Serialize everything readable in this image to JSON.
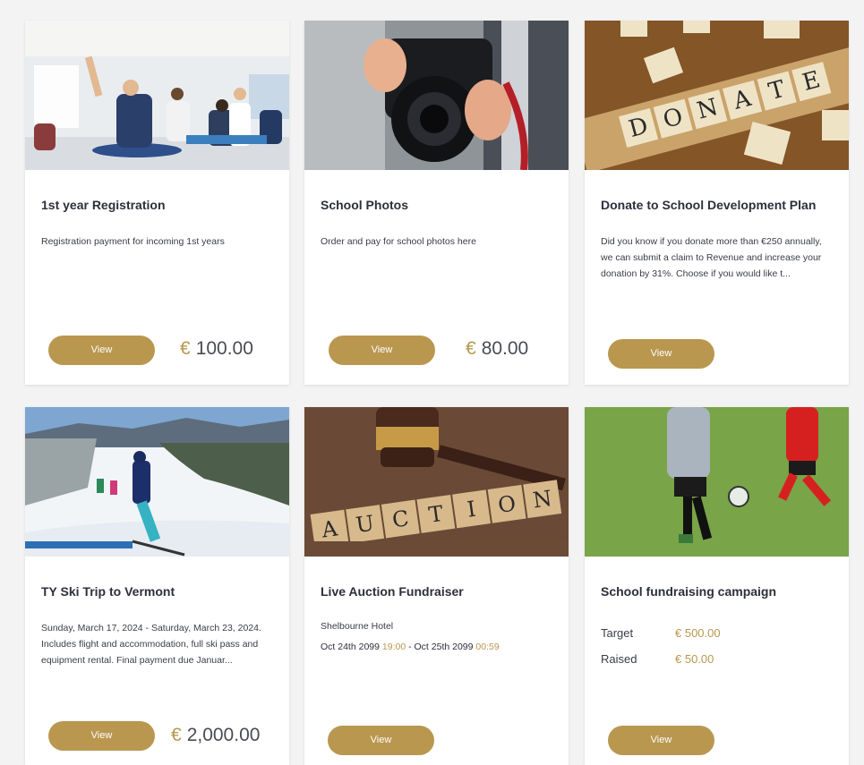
{
  "cards": [
    {
      "title": "1st year Registration",
      "description": "Registration payment for incoming 1st years",
      "button": "View",
      "currency": "€",
      "price": "100.00",
      "image": "classroom-raised-hands-photo"
    },
    {
      "title": "School Photos",
      "description": "Order and pay for school photos here",
      "button": "View",
      "currency": "€",
      "price": "80.00",
      "image": "camera-photographer-photo"
    },
    {
      "title": "Donate to School Development Plan",
      "description": "Did you know if you donate more than €250 annually, we can submit a claim to Revenue and increase your donation by 31%. Choose if you would like t...",
      "button": "View",
      "image": "scrabble-donate-tiles-photo",
      "tiles": [
        "D",
        "O",
        "N",
        "A",
        "T",
        "E"
      ]
    },
    {
      "title": "TY Ski Trip to Vermont",
      "description": "Sunday, March 17, 2024 - Saturday, March 23, 2024. Includes flight and accommodation, full ski pass and equipment rental. Final payment due Januar...",
      "button": "View",
      "currency": "€",
      "price": "2,000.00",
      "image": "ski-slope-photo"
    },
    {
      "title": "Live Auction Fundraiser",
      "location": "Shelbourne Hotel",
      "start_date": "Oct 24th 2099",
      "start_time": "19:00",
      "separator": "-",
      "end_date": "Oct 25th 2099",
      "end_time": "00:59",
      "button": "View",
      "image": "auction-gavel-photo",
      "tiles": [
        "A",
        "U",
        "C",
        "T",
        "I",
        "O",
        "N"
      ]
    },
    {
      "title": "School fundraising campaign",
      "target_label": "Target",
      "target_value": "€ 500.00",
      "raised_label": "Raised",
      "raised_value": "€ 50.00",
      "button": "View",
      "image": "kids-soccer-photo"
    }
  ],
  "colors": {
    "accent": "#b9974f",
    "background": "#f3f3f4",
    "card": "#ffffff",
    "title_text": "#2d2f3b"
  }
}
